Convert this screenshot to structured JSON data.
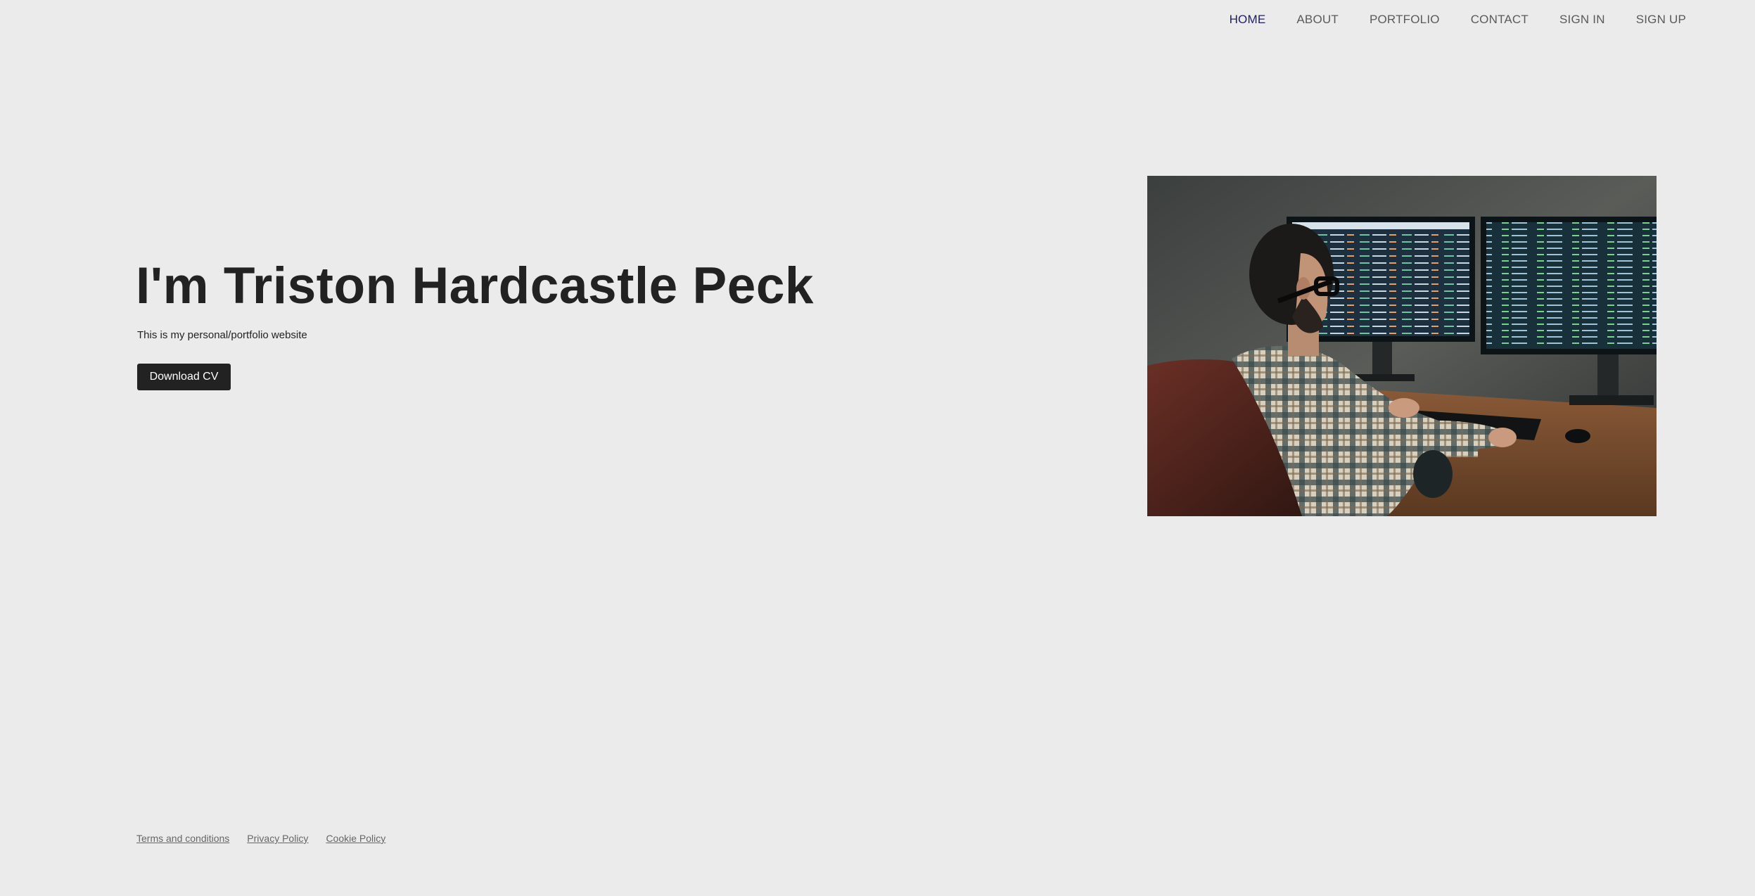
{
  "nav": {
    "items": [
      {
        "label": "HOME",
        "active": true
      },
      {
        "label": "ABOUT",
        "active": false
      },
      {
        "label": "PORTFOLIO",
        "active": false
      },
      {
        "label": "CONTACT",
        "active": false
      },
      {
        "label": "SIGN IN",
        "active": false
      },
      {
        "label": "SIGN UP",
        "active": false
      }
    ],
    "active_color": "#1f1d6b",
    "color": "#5a5a5a"
  },
  "hero": {
    "title": "I'm Triston Hardcastle Peck",
    "subtitle": "This is my personal/portfolio website",
    "cta_label": "Download CV",
    "image_icon": "developer-at-desk-photo"
  },
  "footer": {
    "links": [
      {
        "label": "Terms and conditions"
      },
      {
        "label": "Privacy Policy"
      },
      {
        "label": "Cookie Policy"
      }
    ]
  },
  "colors": {
    "background": "#ebebeb",
    "text": "#222222",
    "button_bg": "#222222",
    "button_text": "#ffffff"
  }
}
